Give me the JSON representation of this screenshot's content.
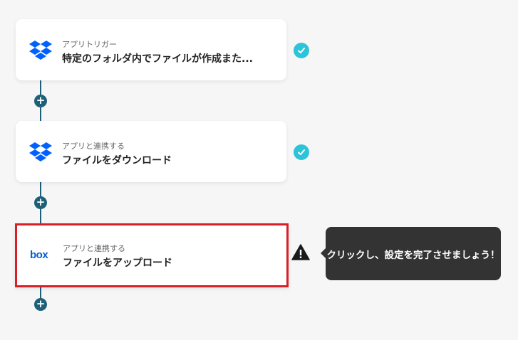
{
  "flow": {
    "steps": [
      {
        "type_label": "アプリトリガー",
        "title": "特定のフォルダ内でファイルが作成また...",
        "app": "dropbox",
        "status": "complete"
      },
      {
        "type_label": "アプリと連携する",
        "title": "ファイルをダウンロード",
        "app": "dropbox",
        "status": "complete"
      },
      {
        "type_label": "アプリと連携する",
        "title": "ファイルをアップロード",
        "app": "box",
        "status": "incomplete"
      }
    ],
    "add_step_symbol": "+"
  },
  "icons": {
    "dropbox": "dropbox-logo-icon",
    "box": "box-logo-icon",
    "check": "check-icon",
    "warning": "warning-icon"
  },
  "tooltip": {
    "text": "クリックし、設定を完了させましょう！"
  },
  "colors": {
    "connector": "#1f6079",
    "check": "#2cc4d8",
    "highlight_border": "#d91f26",
    "tooltip_bg": "#333333",
    "dropbox_blue": "#0061fe",
    "box_blue": "#0061d5"
  }
}
